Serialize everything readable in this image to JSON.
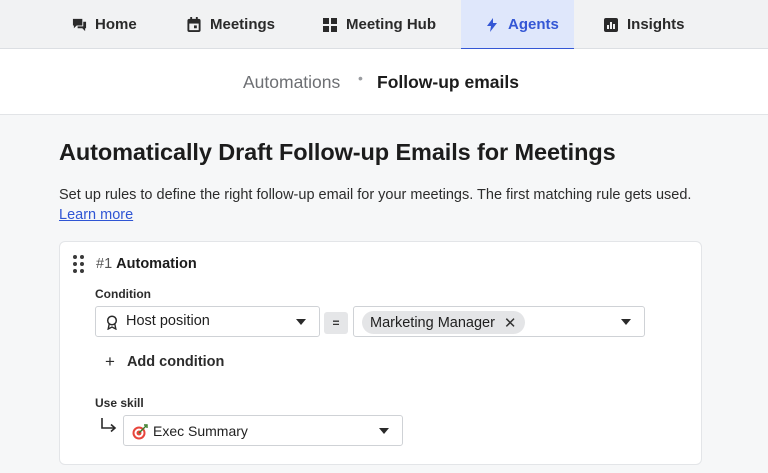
{
  "nav": {
    "tabs": [
      {
        "label": "Home",
        "icon": "chat-bubbles-icon",
        "active": false
      },
      {
        "label": "Meetings",
        "icon": "calendar-icon",
        "active": false
      },
      {
        "label": "Meeting Hub",
        "icon": "grid-icon",
        "active": false
      },
      {
        "label": "Agents",
        "icon": "lightning-icon",
        "active": true
      },
      {
        "label": "Insights",
        "icon": "bar-chart-icon",
        "active": false
      }
    ],
    "accent_color": "#3457d5"
  },
  "breadcrumb": {
    "parent": "Automations",
    "separator": "•",
    "current": "Follow-up emails"
  },
  "page": {
    "title": "Automatically Draft Follow-up Emails for Meetings",
    "description": "Set up rules to define the right follow-up email for your meetings. The first matching rule gets used.",
    "learn_more": "Learn more"
  },
  "automation": {
    "number": "#1",
    "name": "Automation",
    "condition_label": "Condition",
    "field_value": "Host position",
    "operator": "=",
    "value_chip": "Marketing Manager",
    "remove_chip": "✕",
    "add_condition": "Add condition",
    "use_skill_label": "Use skill",
    "skill_value": "Exec Summary",
    "skill_icon": "target-icon"
  }
}
